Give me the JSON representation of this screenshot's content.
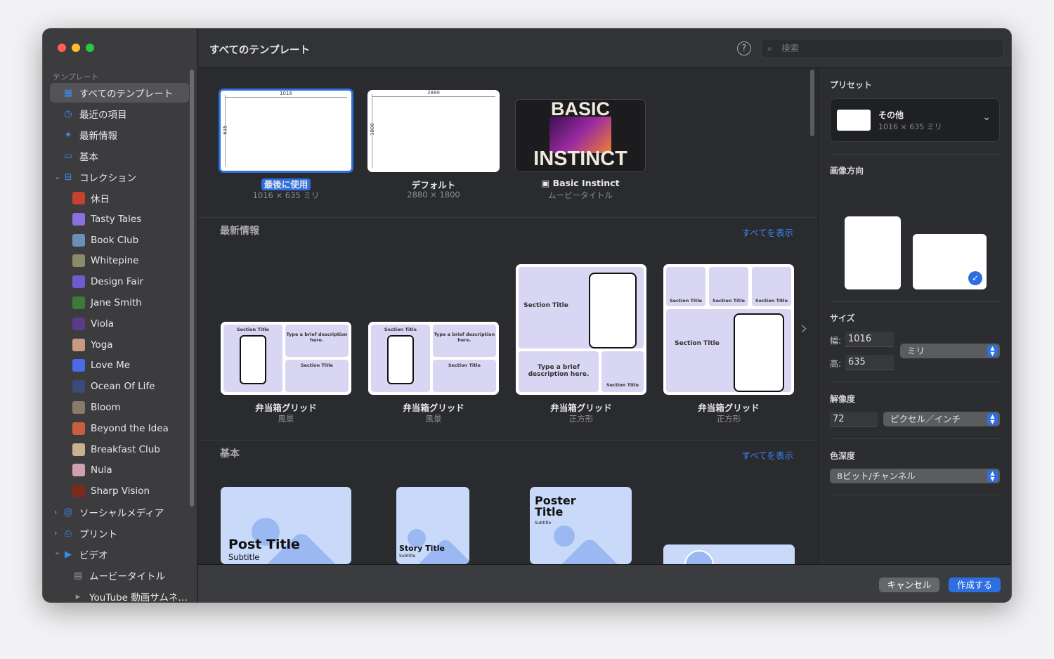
{
  "window": {
    "title": "すべてのテンプレート",
    "search_placeholder": "検索"
  },
  "sidebar": {
    "section_header": "テンプレート",
    "items": [
      {
        "label": "すべてのテンプレート",
        "icon": "grid-icon",
        "selected": true
      },
      {
        "label": "最近の項目",
        "icon": "clock-icon"
      },
      {
        "label": "最新情報",
        "icon": "sparkle-icon"
      },
      {
        "label": "基本",
        "icon": "rectangle-icon"
      },
      {
        "label": "コレクション",
        "icon": "collection-icon",
        "expanded": true
      }
    ],
    "collections": [
      {
        "label": "休日",
        "color": "#c8402e"
      },
      {
        "label": "Tasty Tales",
        "color": "#8a6fe0"
      },
      {
        "label": "Book Club",
        "color": "#6c8fb8"
      },
      {
        "label": "Whitepine",
        "color": "#8a8a6a"
      },
      {
        "label": "Design Fair",
        "color": "#6d5bd0"
      },
      {
        "label": "Jane Smith",
        "color": "#3d7a3a"
      },
      {
        "label": "Viola",
        "color": "#5a3a8a"
      },
      {
        "label": "Yoga",
        "color": "#c89a80"
      },
      {
        "label": "Love Me",
        "color": "#4a6ae8"
      },
      {
        "label": "Ocean Of Life",
        "color": "#3a4a7a"
      },
      {
        "label": "Bloom",
        "color": "#8a7a6a"
      },
      {
        "label": "Beyond the Idea",
        "color": "#c86040"
      },
      {
        "label": "Breakfast Club",
        "color": "#c8b090"
      },
      {
        "label": "Nula",
        "color": "#d0a0b0"
      },
      {
        "label": "Sharp Vision",
        "color": "#7a2a1a"
      }
    ],
    "groups": [
      {
        "label": "ソーシャルメディア",
        "icon": "at-icon",
        "expanded": false
      },
      {
        "label": "プリント",
        "icon": "printer-icon",
        "expanded": false
      },
      {
        "label": "ビデオ",
        "icon": "video-icon",
        "expanded": true
      }
    ],
    "video_items": [
      {
        "label": "ムービータイトル",
        "icon": "film-icon"
      },
      {
        "label": "YouTube 動画サムネ…",
        "icon": "play-icon"
      }
    ]
  },
  "recent": [
    {
      "badge": "最後に使用",
      "sub": "1016 × 635 ミリ",
      "width_label": "1016",
      "height_label": "635",
      "selected": true
    },
    {
      "label": "デフォルト",
      "sub": "2880 × 1800",
      "width_label": "2880",
      "height_label": "1800"
    },
    {
      "label": "Basic Instinct",
      "sub": "ムービータイトル",
      "art_top": "BASIC",
      "art_bottom": "INSTINCT"
    }
  ],
  "whats_new": {
    "title": "最新情報",
    "show_all": "すべてを表示",
    "items": [
      {
        "label": "弁当箱グリッド",
        "sub": "風景"
      },
      {
        "label": "弁当箱グリッド",
        "sub": "風景"
      },
      {
        "label": "弁当箱グリッド",
        "sub": "正方形"
      },
      {
        "label": "弁当箱グリッド",
        "sub": "正方形"
      }
    ],
    "thumb_text": {
      "section": "Section Title",
      "desc": "Type a brief description here."
    }
  },
  "basic": {
    "title": "基本",
    "show_all": "すべてを表示",
    "items": [
      {
        "title": "Post Title",
        "subtitle": "Subtitle"
      },
      {
        "title": "Story Title",
        "subtitle": "Subtitle"
      },
      {
        "title": "Poster Title",
        "subtitle": "Subtitle"
      },
      {
        "title": "",
        "subtitle": ""
      }
    ]
  },
  "panel": {
    "preset_label": "プリセット",
    "preset_name": "その他",
    "preset_size": "1016 × 635 ミリ",
    "orientation_label": "画像方向",
    "orientation": "landscape",
    "size_label": "サイズ",
    "width_label": "幅:",
    "width": "1016",
    "height_label": "高:",
    "height": "635",
    "unit": "ミリ",
    "resolution_label": "解像度",
    "resolution": "72",
    "resolution_unit": "ピクセル／インチ",
    "depth_label": "色深度",
    "depth": "8ビット/チャンネル"
  },
  "footer": {
    "cancel": "キャンセル",
    "create": "作成する"
  },
  "colors": {
    "accent": "#2d6fe0",
    "link": "#3b86ee"
  }
}
